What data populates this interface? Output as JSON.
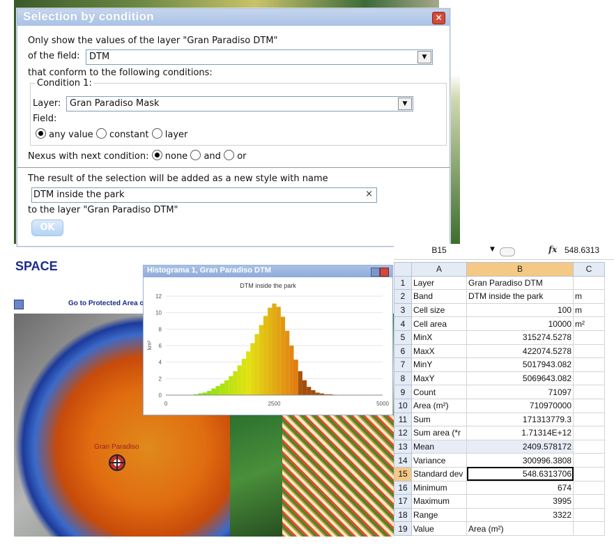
{
  "dialog": {
    "title": "Selection by condition",
    "intro": "Only show the values of the layer \"Gran Paradiso DTM\"",
    "field_label": "of the field:",
    "field_value": "DTM",
    "conditions_label": "that conform to the following conditions:",
    "condition1_legend": "Condition 1:",
    "layer_label": "Layer:",
    "layer_value": "Gran Paradiso Mask",
    "field2_label": "Field:",
    "field_options": [
      "any value",
      "constant",
      "layer"
    ],
    "field_selected": "any value",
    "nexus_label": "Nexus with next condition:",
    "nexus_options": [
      "none",
      "and",
      "or"
    ],
    "nexus_selected": "none",
    "result_label": "The result of the selection will be added as a new style with name",
    "style_name": "DTM inside the park",
    "clear_symbol": "×",
    "target_label": "to the layer \"Gran Paradiso DTM\"",
    "ok_label": "OK"
  },
  "map": {
    "header_fragment": "SPACE",
    "goto_link": "Go to Protected Area o",
    "place_label": "Gran Paradiso"
  },
  "histogram_window": {
    "title": "Histograma 1, Gran Paradiso DTM",
    "chart_title": "DTM inside the park",
    "y_axis_label": "km²"
  },
  "chart_data": {
    "type": "bar",
    "title": "DTM inside the park",
    "xlabel": "",
    "ylabel": "km²",
    "xlim": [
      0,
      5000
    ],
    "ylim": [
      0,
      12
    ],
    "x_ticks": [
      "0",
      "2500",
      "5000"
    ],
    "y_ticks": [
      "0",
      "2",
      "4",
      "6",
      "8",
      "10",
      "12"
    ],
    "series": [
      {
        "x": [
          700,
          800,
          900,
          1000,
          1100,
          1200,
          1300,
          1400,
          1500,
          1600,
          1700,
          1800,
          1900,
          2000,
          2100,
          2200,
          2300,
          2400,
          2500,
          2600,
          2700,
          2800,
          2900,
          3000,
          3100,
          3200,
          3300,
          3400,
          3500,
          3600,
          3700,
          3800,
          3900,
          4000
        ],
        "values": [
          0.1,
          0.2,
          0.3,
          0.5,
          0.8,
          1.1,
          1.4,
          1.8,
          2.3,
          2.9,
          3.6,
          4.4,
          5.3,
          6.3,
          7.4,
          8.5,
          9.6,
          10.6,
          11.1,
          10.7,
          9.5,
          7.8,
          6.0,
          4.3,
          2.9,
          1.8,
          1.0,
          0.6,
          0.3,
          0.2,
          0.1,
          0.1,
          0.05,
          0.02
        ]
      }
    ]
  },
  "spreadsheet": {
    "cell_ref": "B15",
    "formula_value": "548.6313",
    "columns": [
      "A",
      "B",
      "C"
    ],
    "rows": [
      {
        "n": "1",
        "a": "Layer",
        "b": "Gran Paradiso DTM",
        "c": ""
      },
      {
        "n": "2",
        "a": "Band",
        "b": "DTM inside the park",
        "c": "m"
      },
      {
        "n": "3",
        "a": "Cell size",
        "b": "100",
        "c": "m"
      },
      {
        "n": "4",
        "a": "Cell area",
        "b": "10000",
        "c": "m²"
      },
      {
        "n": "5",
        "a": "MinX",
        "b": "315274.5278",
        "c": ""
      },
      {
        "n": "6",
        "a": "MaxX",
        "b": "422074.5278",
        "c": ""
      },
      {
        "n": "7",
        "a": "MinY",
        "b": "5017943.082",
        "c": ""
      },
      {
        "n": "8",
        "a": "MaxY",
        "b": "5069643.082",
        "c": ""
      },
      {
        "n": "9",
        "a": "Count",
        "b": "71097",
        "c": ""
      },
      {
        "n": "10",
        "a": "Area (m²)",
        "b": "710970000",
        "c": ""
      },
      {
        "n": "11",
        "a": "Sum",
        "b": "171313779.3",
        "c": ""
      },
      {
        "n": "12",
        "a": "Sum area (*r",
        "b": "1.71314E+12",
        "c": ""
      },
      {
        "n": "13",
        "a": "Mean",
        "b": "2409.578172",
        "c": ""
      },
      {
        "n": "14",
        "a": "Variance",
        "b": "300996.3808",
        "c": ""
      },
      {
        "n": "15",
        "a": "Standard dev",
        "b": "548.6313706",
        "c": ""
      },
      {
        "n": "16",
        "a": "Minimum",
        "b": "674",
        "c": ""
      },
      {
        "n": "17",
        "a": "Maximum",
        "b": "3995",
        "c": ""
      },
      {
        "n": "18",
        "a": "Range",
        "b": "3322",
        "c": ""
      },
      {
        "n": "19",
        "a": "Value",
        "b": "Area (m²)",
        "c": ""
      }
    ]
  },
  "icons": {
    "close": "close-icon",
    "dropdown": "chevron-down-icon",
    "map_marker": "crosshair-icon",
    "fx": "fx-icon"
  },
  "colors": {
    "dialog_title_bg": "#aac2e6",
    "close_red": "#d34a3a",
    "ok_button": "#b3d3f3",
    "link_blue": "#1a2a8c",
    "row_header_selected": "#f5c984"
  }
}
